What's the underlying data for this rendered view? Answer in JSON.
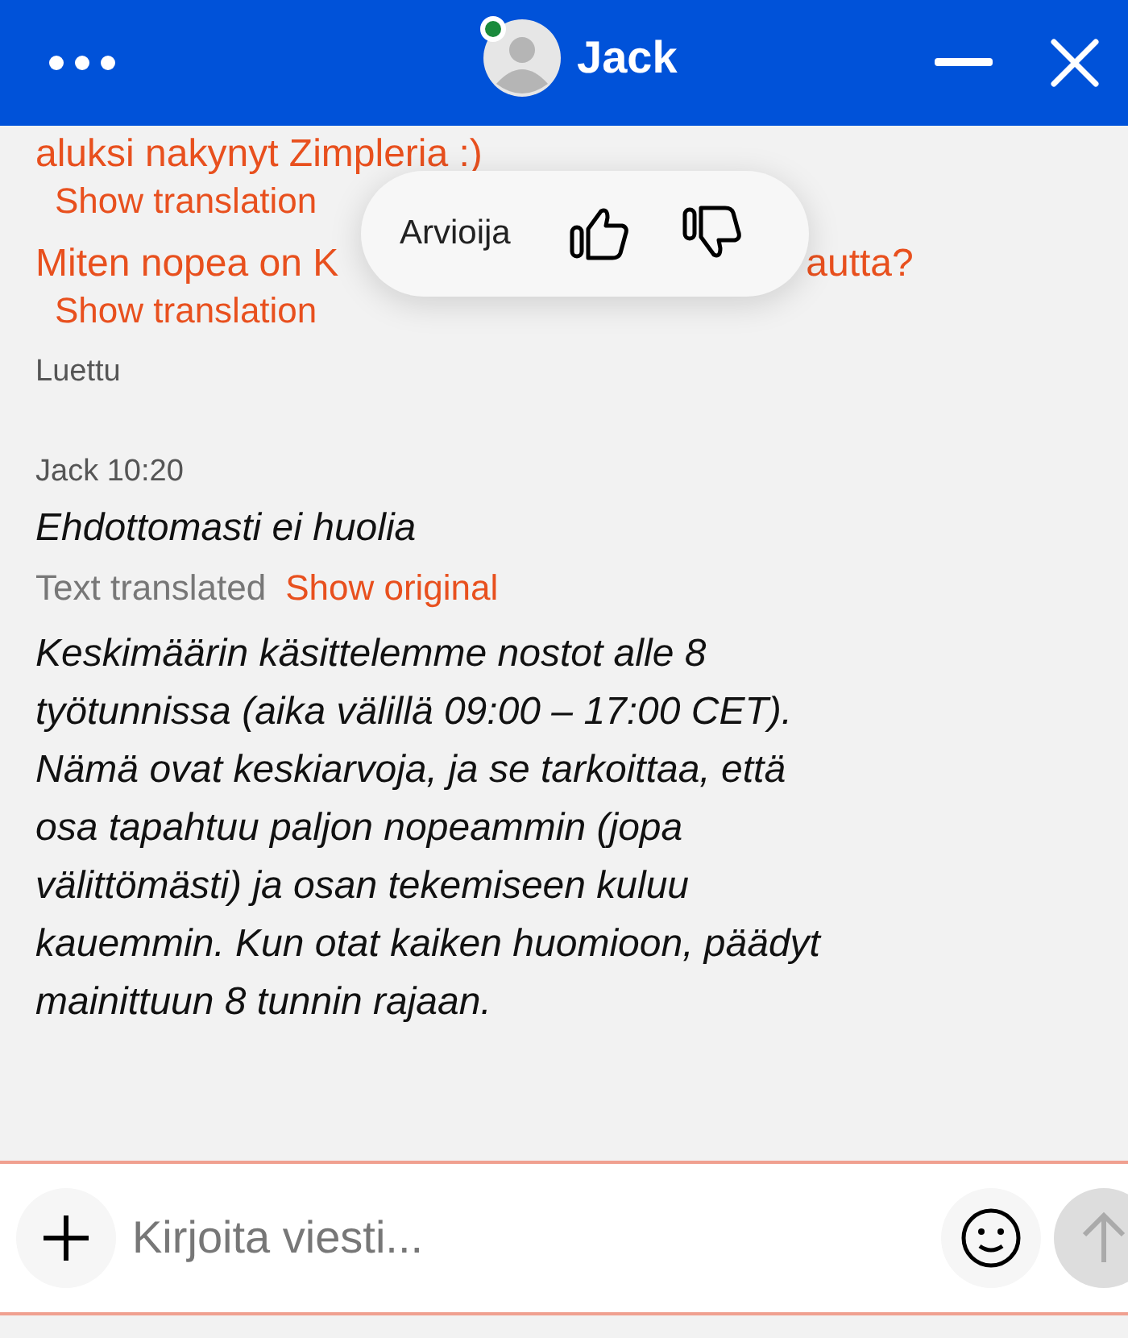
{
  "header": {
    "title": "Jack",
    "online": true
  },
  "earlier_messages": [
    {
      "parts": [
        "aluksi nakynyt Zimpleria :)"
      ],
      "link": "Show translation"
    },
    {
      "parts": [
        "Miten nopea on K",
        "autta?"
      ],
      "link": "Show translation"
    }
  ],
  "read_status": "Luettu",
  "rating_popup": {
    "label": "Arvioija"
  },
  "reply": {
    "sender_time": "Jack 10:20",
    "translated_text": "Ehdottomasti ei huolia",
    "translated_note": "Text translated",
    "original_link": "Show original",
    "body": "Keskimäärin käsittelemme nostot alle 8 työtunnissa (aika välillä 09:00 – 17:00 CET). Nämä ovat keskiarvoja, ja se tarkoittaa, että osa tapahtuu paljon nopeammin (jopa välittömästi) ja osan tekemiseen kuluu kauemmin. Kun otat kaiken huomioon, päädyt mainittuun 8 tunnin rajaan."
  },
  "composer": {
    "placeholder": "Kirjoita viesti..."
  }
}
